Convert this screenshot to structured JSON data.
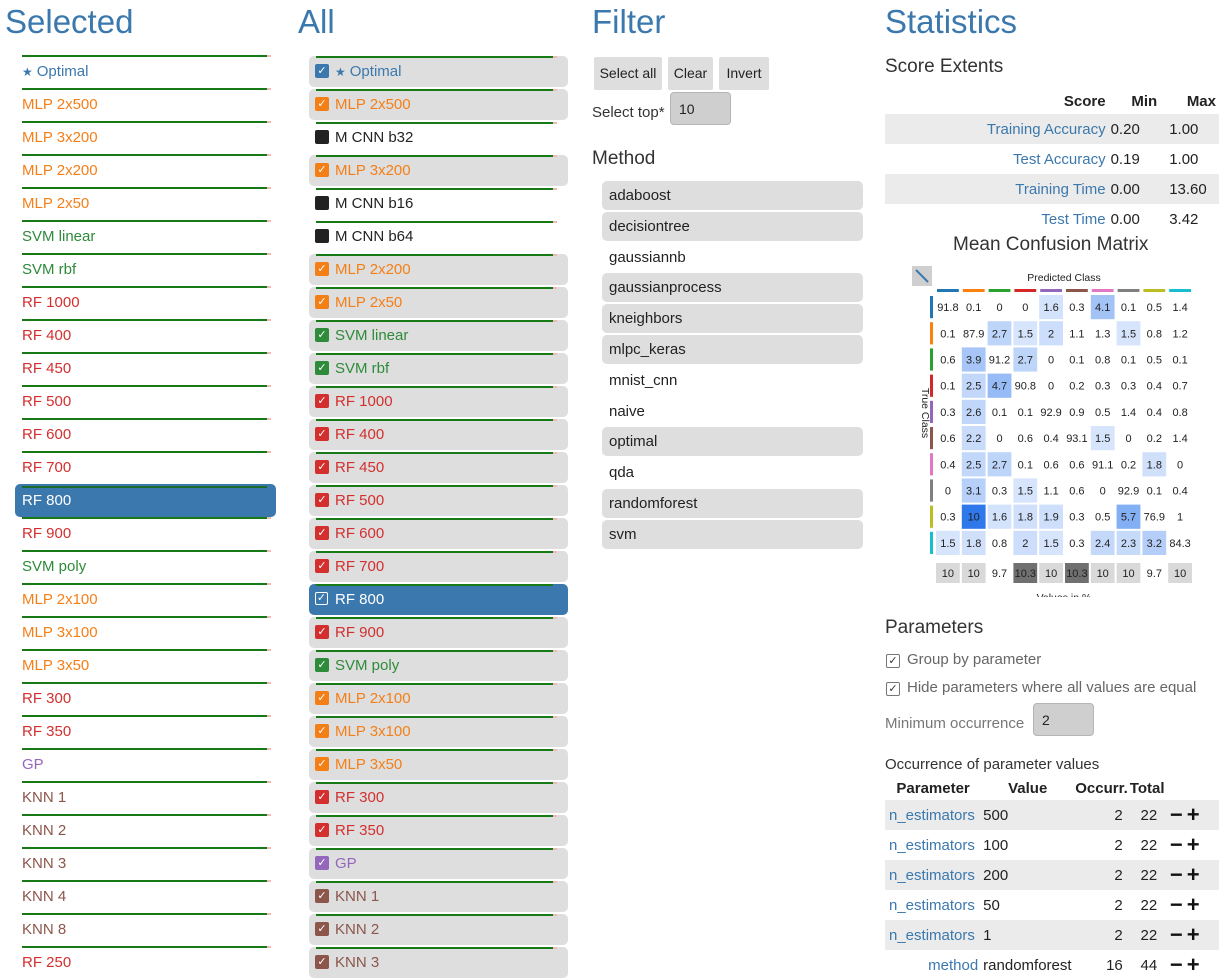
{
  "colors": {
    "accent": "#3b78ad",
    "optimal": "#3b78ad",
    "mlp": "#f57f17",
    "svm": "#2e8b3a",
    "rf": "#d32f2f",
    "gp": "#9467bd",
    "knn": "#8c564b",
    "cnn": "#222222",
    "score_bar": "#177a17"
  },
  "selected": {
    "title": "Selected",
    "items": [
      {
        "label": "Optimal",
        "group": "optimal",
        "star": true
      },
      {
        "label": "MLP 2x500",
        "group": "mlp"
      },
      {
        "label": "MLP 3x200",
        "group": "mlp"
      },
      {
        "label": "MLP 2x200",
        "group": "mlp"
      },
      {
        "label": "MLP 2x50",
        "group": "mlp"
      },
      {
        "label": "SVM linear",
        "group": "svm"
      },
      {
        "label": "SVM rbf",
        "group": "svm"
      },
      {
        "label": "RF 1000",
        "group": "rf"
      },
      {
        "label": "RF 400",
        "group": "rf"
      },
      {
        "label": "RF 450",
        "group": "rf"
      },
      {
        "label": "RF 500",
        "group": "rf"
      },
      {
        "label": "RF 600",
        "group": "rf"
      },
      {
        "label": "RF 700",
        "group": "rf"
      },
      {
        "label": "RF 800",
        "group": "rf",
        "active": true
      },
      {
        "label": "RF 900",
        "group": "rf"
      },
      {
        "label": "SVM poly",
        "group": "svm"
      },
      {
        "label": "MLP 2x100",
        "group": "mlp"
      },
      {
        "label": "MLP 3x100",
        "group": "mlp"
      },
      {
        "label": "MLP 3x50",
        "group": "mlp"
      },
      {
        "label": "RF 300",
        "group": "rf"
      },
      {
        "label": "RF 350",
        "group": "rf"
      },
      {
        "label": "GP",
        "group": "gp"
      },
      {
        "label": "KNN 1",
        "group": "knn"
      },
      {
        "label": "KNN 2",
        "group": "knn"
      },
      {
        "label": "KNN 3",
        "group": "knn"
      },
      {
        "label": "KNN 4",
        "group": "knn"
      },
      {
        "label": "KNN 8",
        "group": "knn"
      },
      {
        "label": "RF 250",
        "group": "rf"
      }
    ]
  },
  "all": {
    "title": "All",
    "items": [
      {
        "label": "Optimal",
        "group": "optimal",
        "on": true,
        "star": true
      },
      {
        "label": "MLP 2x500",
        "group": "mlp",
        "on": true
      },
      {
        "label": "M CNN b32",
        "group": "cnn",
        "on": false
      },
      {
        "label": "MLP 3x200",
        "group": "mlp",
        "on": true
      },
      {
        "label": "M CNN b16",
        "group": "cnn",
        "on": false
      },
      {
        "label": "M CNN b64",
        "group": "cnn",
        "on": false
      },
      {
        "label": "MLP 2x200",
        "group": "mlp",
        "on": true
      },
      {
        "label": "MLP 2x50",
        "group": "mlp",
        "on": true
      },
      {
        "label": "SVM linear",
        "group": "svm",
        "on": true
      },
      {
        "label": "SVM rbf",
        "group": "svm",
        "on": true
      },
      {
        "label": "RF 1000",
        "group": "rf",
        "on": true
      },
      {
        "label": "RF 400",
        "group": "rf",
        "on": true
      },
      {
        "label": "RF 450",
        "group": "rf",
        "on": true
      },
      {
        "label": "RF 500",
        "group": "rf",
        "on": true
      },
      {
        "label": "RF 600",
        "group": "rf",
        "on": true
      },
      {
        "label": "RF 700",
        "group": "rf",
        "on": true
      },
      {
        "label": "RF 800",
        "group": "rf",
        "on": true,
        "active": true
      },
      {
        "label": "RF 900",
        "group": "rf",
        "on": true
      },
      {
        "label": "SVM poly",
        "group": "svm",
        "on": true
      },
      {
        "label": "MLP 2x100",
        "group": "mlp",
        "on": true
      },
      {
        "label": "MLP 3x100",
        "group": "mlp",
        "on": true
      },
      {
        "label": "MLP 3x50",
        "group": "mlp",
        "on": true
      },
      {
        "label": "RF 300",
        "group": "rf",
        "on": true
      },
      {
        "label": "RF 350",
        "group": "rf",
        "on": true
      },
      {
        "label": "GP",
        "group": "gp",
        "on": true
      },
      {
        "label": "KNN 1",
        "group": "knn",
        "on": true
      },
      {
        "label": "KNN 2",
        "group": "knn",
        "on": true
      },
      {
        "label": "KNN 3",
        "group": "knn",
        "on": true
      }
    ]
  },
  "filter": {
    "title": "Filter",
    "select_all": "Select all",
    "clear": "Clear",
    "invert": "Invert",
    "select_top_label": "Select top*",
    "select_top_value": "10",
    "method_title": "Method",
    "methods": [
      {
        "label": "adaboost",
        "on": true
      },
      {
        "label": "decisiontree",
        "on": true
      },
      {
        "label": "gaussiannb",
        "on": false
      },
      {
        "label": "gaussianprocess",
        "on": true
      },
      {
        "label": "kneighbors",
        "on": true
      },
      {
        "label": "mlpc_keras",
        "on": true
      },
      {
        "label": "mnist_cnn",
        "on": false
      },
      {
        "label": "naive",
        "on": false
      },
      {
        "label": "optimal",
        "on": true
      },
      {
        "label": "qda",
        "on": false
      },
      {
        "label": "randomforest",
        "on": true
      },
      {
        "label": "svm",
        "on": true
      }
    ]
  },
  "stats": {
    "title": "Statistics",
    "extents_title": "Score Extents",
    "extents_headers": [
      "Score",
      "Min",
      "Max"
    ],
    "extents_rows": [
      {
        "name": "Training Accuracy",
        "min": "0.20",
        "max": "1.00"
      },
      {
        "name": "Test Accuracy",
        "min": "0.19",
        "max": "1.00"
      },
      {
        "name": "Training Time",
        "min": "0.00",
        "max": "13.60"
      },
      {
        "name": "Test Time",
        "min": "0.00",
        "max": "3.42"
      }
    ],
    "cm_title": "Mean Confusion Matrix",
    "cm_xlabel": "Predicted Class",
    "cm_ylabel": "True Class",
    "cm_footer": "Values in %",
    "cm_class_colors": [
      "#1f77b4",
      "#ff7f0e",
      "#2ca02c",
      "#d62728",
      "#9467bd",
      "#8c564b",
      "#e377c2",
      "#7f7f7f",
      "#bcbd22",
      "#17becf"
    ],
    "cm_matrix": [
      [
        "91.8",
        "0.1",
        "0",
        "0",
        "1.6",
        "0.3",
        "4.1",
        "0.1",
        "0.5",
        "1.4"
      ],
      [
        "0.1",
        "87.9",
        "2.7",
        "1.5",
        "2",
        "1.1",
        "1.3",
        "1.5",
        "0.8",
        "1.2"
      ],
      [
        "0.6",
        "3.9",
        "91.2",
        "2.7",
        "0",
        "0.1",
        "0.8",
        "0.1",
        "0.5",
        "0.1"
      ],
      [
        "0.1",
        "2.5",
        "4.7",
        "90.8",
        "0",
        "0.2",
        "0.3",
        "0.3",
        "0.4",
        "0.7"
      ],
      [
        "0.3",
        "2.6",
        "0.1",
        "0.1",
        "92.9",
        "0.9",
        "0.5",
        "1.4",
        "0.4",
        "0.8"
      ],
      [
        "0.6",
        "2.2",
        "0",
        "0.6",
        "0.4",
        "93.1",
        "1.5",
        "0",
        "0.2",
        "1.4"
      ],
      [
        "0.4",
        "2.5",
        "2.7",
        "0.1",
        "0.6",
        "0.6",
        "91.1",
        "0.2",
        "1.8",
        "0"
      ],
      [
        "0",
        "3.1",
        "0.3",
        "1.5",
        "1.1",
        "0.6",
        "0",
        "92.9",
        "0.1",
        "0.4"
      ],
      [
        "0.3",
        "10",
        "1.6",
        "1.8",
        "1.9",
        "0.3",
        "0.5",
        "5.7",
        "76.9",
        "1"
      ],
      [
        "1.5",
        "1.8",
        "0.8",
        "2",
        "1.5",
        "0.3",
        "2.4",
        "2.3",
        "3.2",
        "84.3"
      ]
    ],
    "cm_totals": [
      "10",
      "10",
      "9.7",
      "10.3",
      "10",
      "10.3",
      "10",
      "10",
      "9.7",
      "10"
    ],
    "params_title": "Parameters",
    "group_by_param": "Group by parameter",
    "hide_equal": "Hide parameters where all values are equal",
    "min_occ_label": "Minimum occurrence",
    "min_occ_value": "2",
    "occ_title": "Occurrence of parameter values",
    "occ_headers": [
      "Parameter",
      "Value",
      "Occurr.",
      "Total"
    ],
    "occ_rows": [
      {
        "param": "n_estimators",
        "value": "500",
        "occ": "2",
        "total": "22"
      },
      {
        "param": "n_estimators",
        "value": "100",
        "occ": "2",
        "total": "22"
      },
      {
        "param": "n_estimators",
        "value": "200",
        "occ": "2",
        "total": "22"
      },
      {
        "param": "n_estimators",
        "value": "50",
        "occ": "2",
        "total": "22"
      },
      {
        "param": "n_estimators",
        "value": "1",
        "occ": "2",
        "total": "22"
      },
      {
        "param": "method",
        "value": "randomforest",
        "occ": "16",
        "total": "44"
      }
    ]
  }
}
